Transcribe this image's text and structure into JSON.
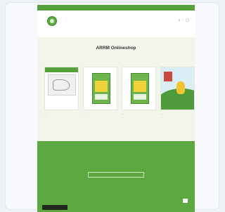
{
  "announcement": "",
  "header": {
    "nav": [
      "",
      "",
      "",
      ""
    ]
  },
  "hero": {
    "title": "ARRM Onlineshop",
    "subtitle": ""
  },
  "products": [
    {
      "label": "",
      "arrow": "→"
    },
    {
      "label": "",
      "arrow": "→"
    },
    {
      "label": "",
      "arrow": "→"
    },
    {
      "label": "",
      "arrow": "→"
    }
  ],
  "footer": {
    "heading": "",
    "links": [
      "",
      "",
      "",
      "",
      ""
    ],
    "text": "",
    "input_placeholder": "",
    "meta": "",
    "copyright": ""
  },
  "chat_label": "",
  "colors": {
    "brand_green": "#5ea842",
    "hero_bg": "#f2f5ea"
  }
}
